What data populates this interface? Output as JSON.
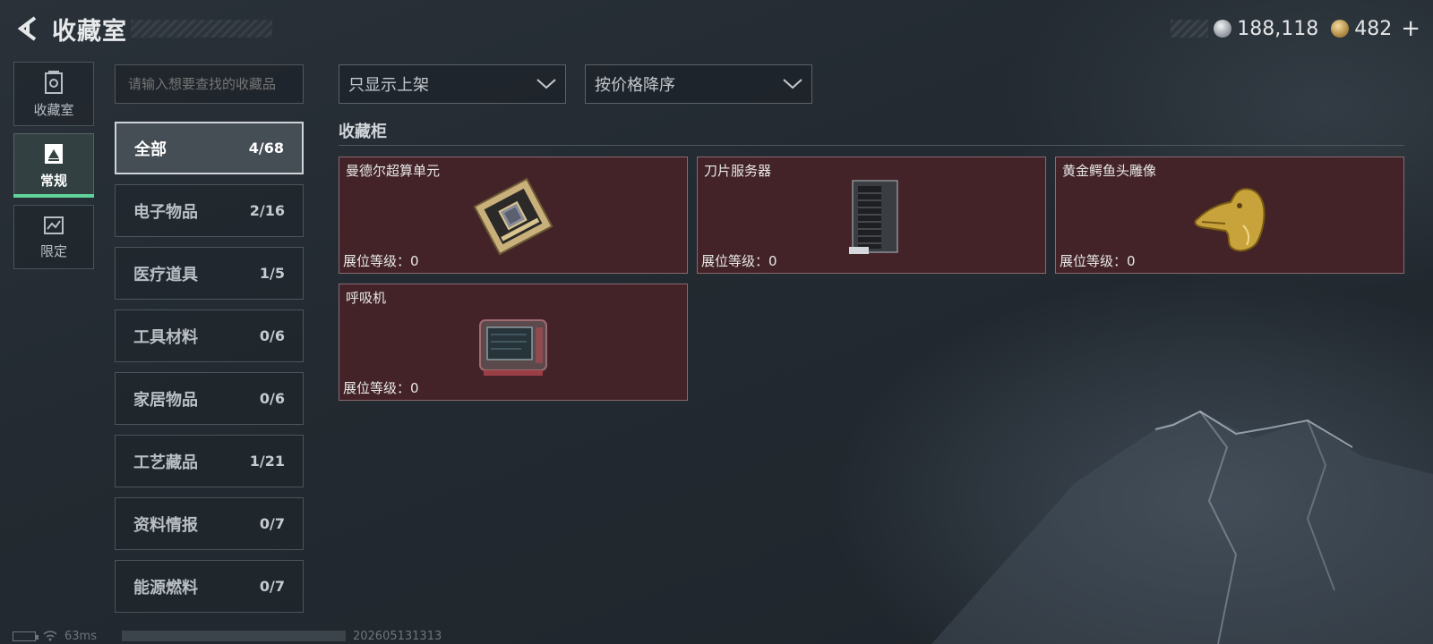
{
  "header": {
    "title": "收藏室",
    "back_icon": "back-arrow-icon"
  },
  "currency": {
    "silver_value": "188,118",
    "gold_value": "482",
    "plus": "+"
  },
  "left_nav": {
    "items": [
      {
        "label": "收藏室",
        "icon": "collection-room-icon",
        "active": false
      },
      {
        "label": "常规",
        "icon": "regular-icon",
        "active": true
      },
      {
        "label": "限定",
        "icon": "limited-icon",
        "active": false
      }
    ]
  },
  "search": {
    "placeholder": "请输入想要查找的收藏品"
  },
  "categories": [
    {
      "name": "全部",
      "count": "4/68",
      "active": true
    },
    {
      "name": "电子物品",
      "count": "2/16",
      "active": false
    },
    {
      "name": "医疗道具",
      "count": "1/5",
      "active": false
    },
    {
      "name": "工具材料",
      "count": "0/6",
      "active": false
    },
    {
      "name": "家居物品",
      "count": "0/6",
      "active": false
    },
    {
      "name": "工艺藏品",
      "count": "1/21",
      "active": false
    },
    {
      "name": "资料情报",
      "count": "0/7",
      "active": false
    },
    {
      "name": "能源燃料",
      "count": "0/7",
      "active": false
    }
  ],
  "filters": {
    "display": "只显示上架",
    "sort": "按价格降序"
  },
  "cabinet": {
    "title": "收藏柜",
    "level_label": "展位等级：",
    "slots": [
      {
        "name": "曼德尔超算单元",
        "level": "0",
        "icon": "supercomputer-unit-icon"
      },
      {
        "name": "刀片服务器",
        "level": "0",
        "icon": "blade-server-icon"
      },
      {
        "name": "黄金鳄鱼头雕像",
        "level": "0",
        "icon": "golden-crocodile-statue-icon"
      },
      {
        "name": "呼吸机",
        "level": "0",
        "icon": "ventilator-icon"
      }
    ]
  },
  "status": {
    "ping": "63ms",
    "code": "202605131313"
  },
  "colors": {
    "accent": "#5fd39a",
    "slot_bg": "#432328",
    "background": "#242b32"
  }
}
